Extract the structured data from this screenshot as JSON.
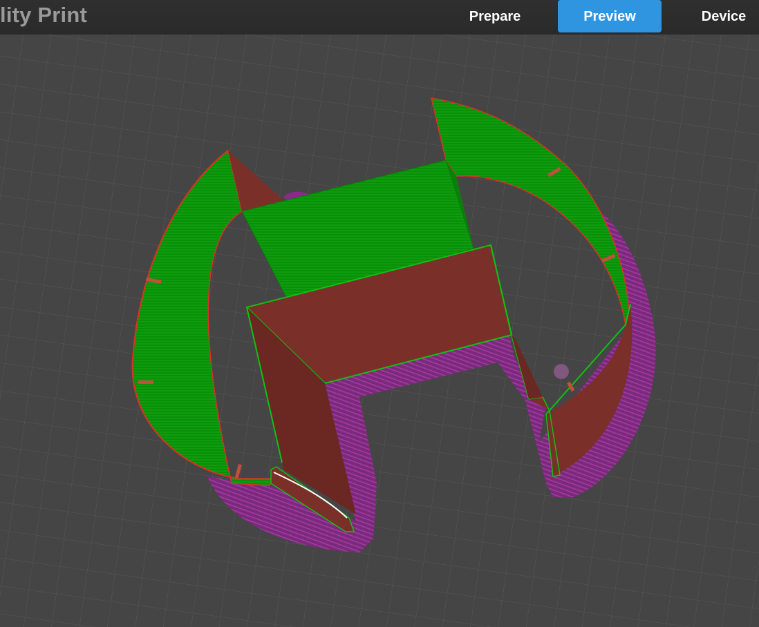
{
  "app": {
    "title": "lity Print"
  },
  "tabs": [
    {
      "label": "Prepare",
      "active": false
    },
    {
      "label": "Preview",
      "active": true
    },
    {
      "label": "Device",
      "active": false
    }
  ],
  "colors": {
    "background": "#454545",
    "grid": "#555555",
    "active_tab": "#2f95e0",
    "inner_wall": "#0a9a0a",
    "outer_wall": "#7a2f28",
    "skirt": "#8a2a8a"
  }
}
